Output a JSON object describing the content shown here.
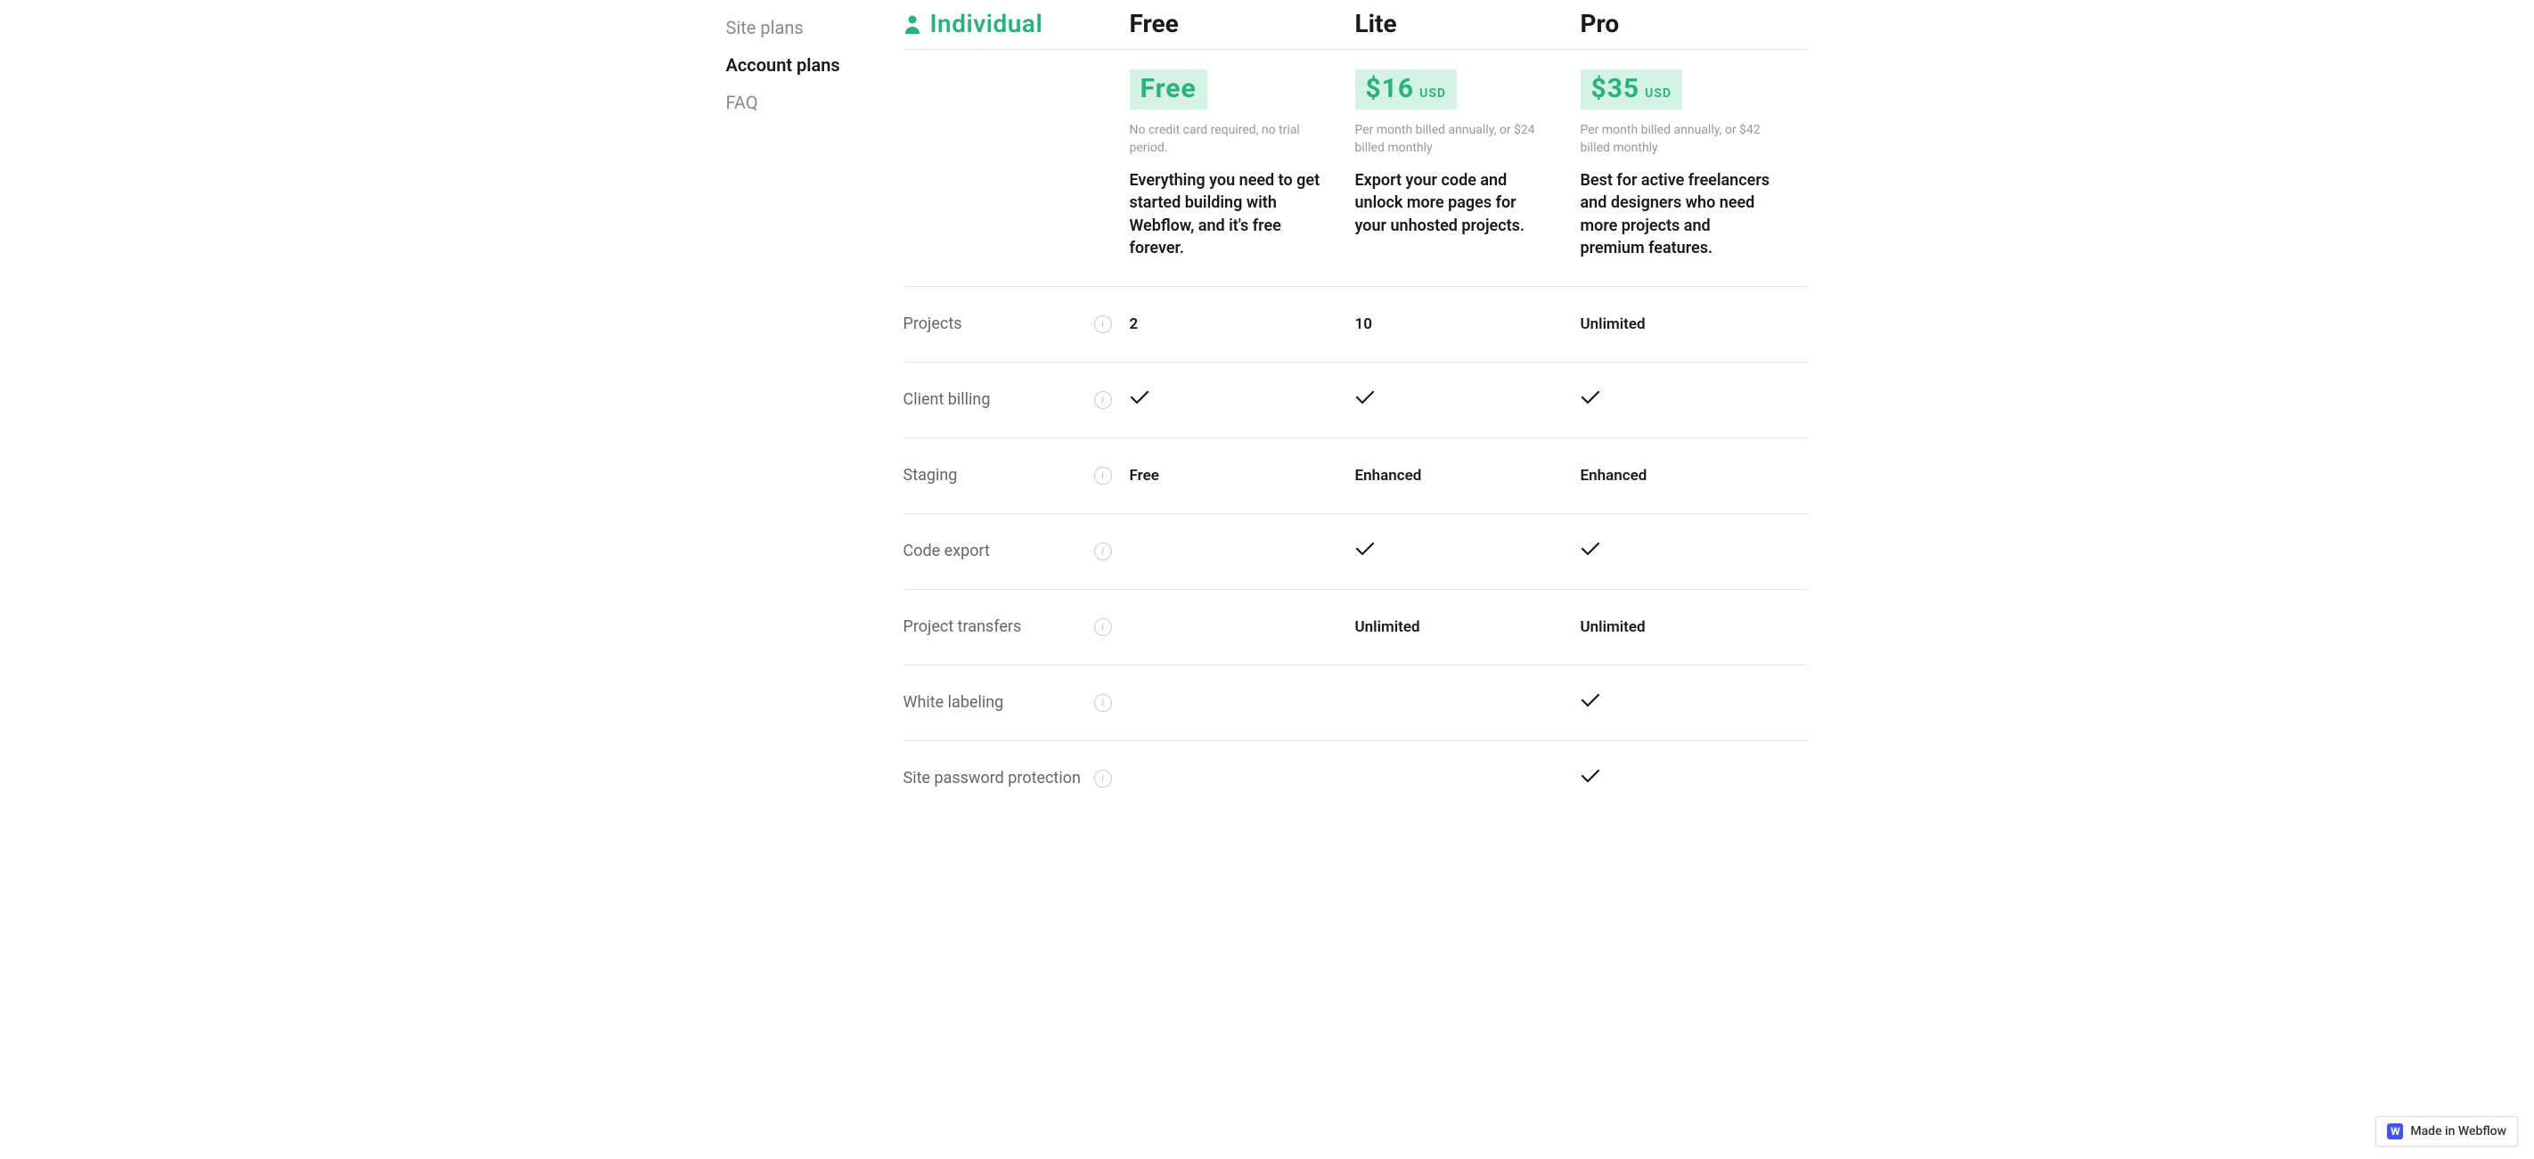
{
  "nav": {
    "site_plans": "Site plans",
    "account_plans": "Account plans",
    "faq": "FAQ"
  },
  "header": {
    "individual": "Individual",
    "plans": {
      "free": "Free",
      "lite": "Lite",
      "pro": "Pro"
    }
  },
  "pricing": {
    "free": {
      "price": "Free",
      "usd": "",
      "note": "No credit card required, no trial period.",
      "desc": "Everything you need to get started building with Webflow, and it's free forever."
    },
    "lite": {
      "price": "$16",
      "usd": "USD",
      "note": "Per month billed annually, or $24 billed monthly",
      "desc": "Export your code and unlock more pages for your unhosted projects."
    },
    "pro": {
      "price": "$35",
      "usd": "USD",
      "note": "Per month billed annually, or $42 billed monthly",
      "desc": "Best for active freelancers and designers who need more projects and premium features."
    }
  },
  "features": [
    {
      "name": "Projects",
      "free": "2",
      "lite": "10",
      "pro": "Unlimited"
    },
    {
      "name": "Client billing",
      "free": "✓",
      "lite": "✓",
      "pro": "✓"
    },
    {
      "name": "Staging",
      "free": "Free",
      "lite": "Enhanced",
      "pro": "Enhanced"
    },
    {
      "name": "Code export",
      "free": "",
      "lite": "✓",
      "pro": "✓"
    },
    {
      "name": "Project transfers",
      "free": "",
      "lite": "Unlimited",
      "pro": "Unlimited"
    },
    {
      "name": "White labeling",
      "free": "",
      "lite": "",
      "pro": "✓"
    },
    {
      "name": "Site password protection",
      "free": "",
      "lite": "",
      "pro": "✓"
    }
  ],
  "badge": {
    "label": "Made in Webflow",
    "logo_letter": "W"
  },
  "chart_data": {
    "type": "table",
    "title": "Individual account plans comparison",
    "columns": [
      "Feature",
      "Free",
      "Lite",
      "Pro"
    ],
    "prices_usd_per_month_annual": {
      "Free": 0,
      "Lite": 16,
      "Pro": 35
    },
    "prices_usd_per_month_monthly": {
      "Free": 0,
      "Lite": 24,
      "Pro": 42
    },
    "rows": [
      [
        "Projects",
        "2",
        "10",
        "Unlimited"
      ],
      [
        "Client billing",
        true,
        true,
        true
      ],
      [
        "Staging",
        "Free",
        "Enhanced",
        "Enhanced"
      ],
      [
        "Code export",
        false,
        true,
        true
      ],
      [
        "Project transfers",
        "",
        "Unlimited",
        "Unlimited"
      ],
      [
        "White labeling",
        false,
        false,
        true
      ],
      [
        "Site password protection",
        false,
        false,
        true
      ]
    ]
  }
}
